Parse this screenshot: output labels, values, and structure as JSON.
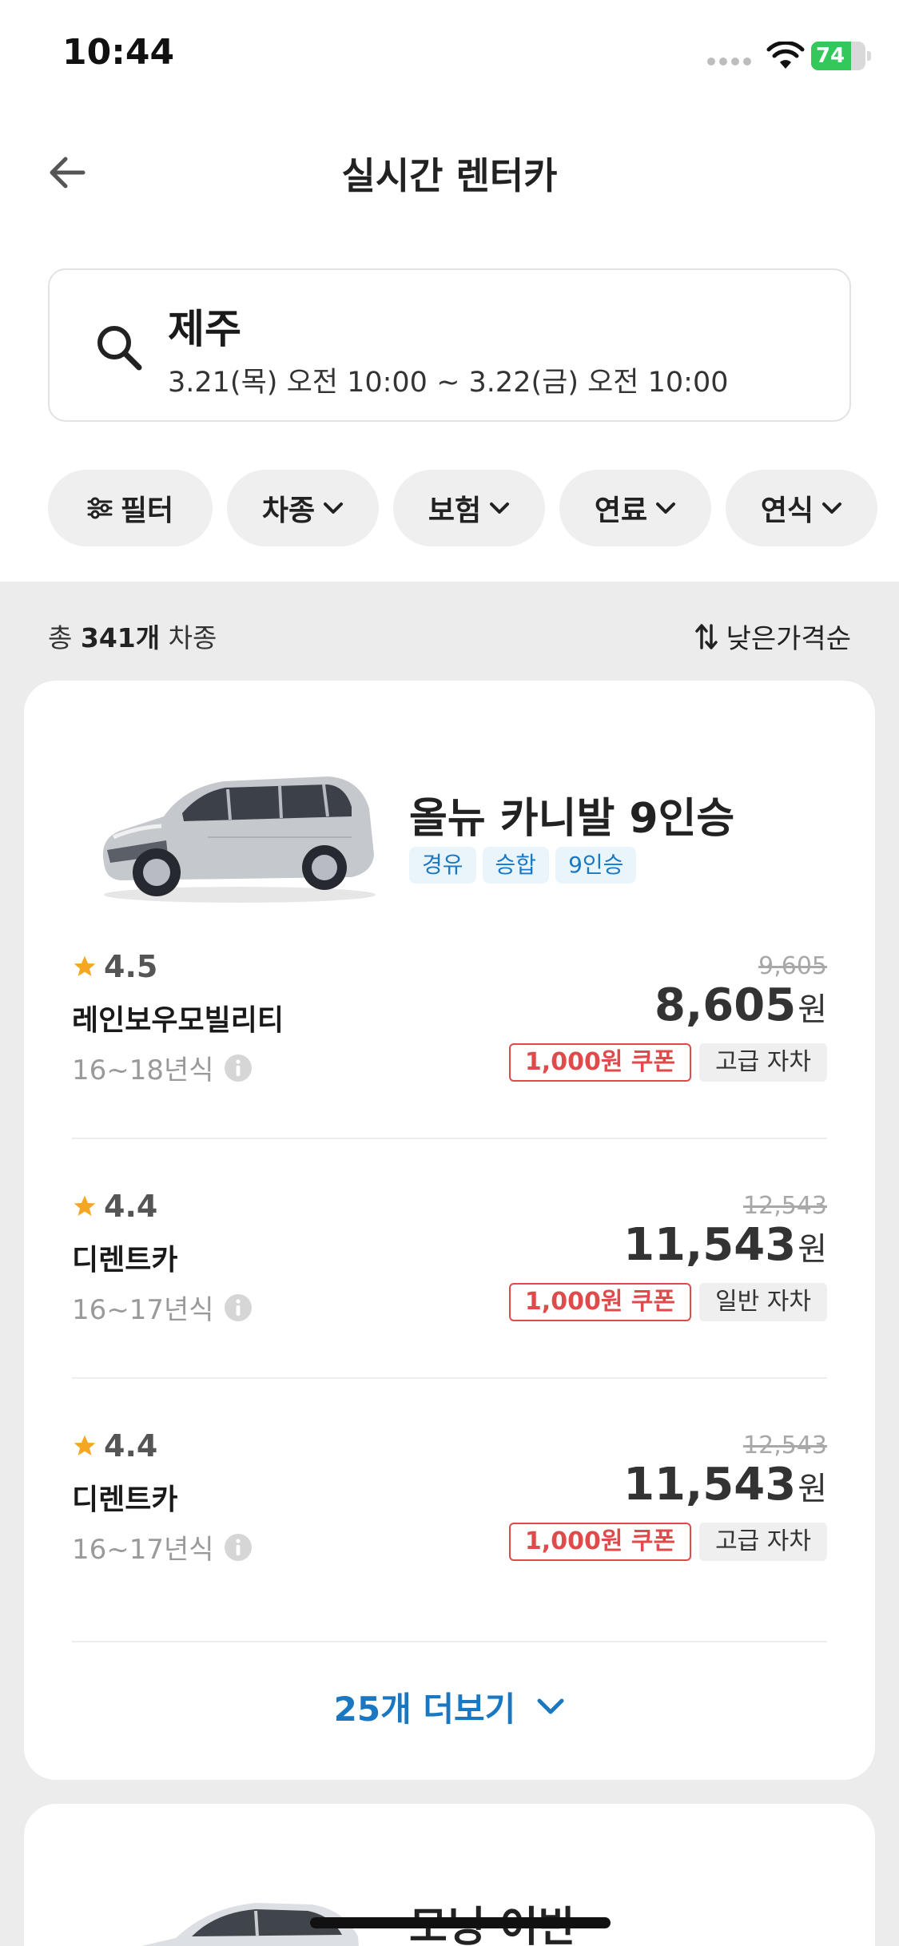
{
  "status_bar": {
    "time": "10:44",
    "battery": "74",
    "battery_level": 0.74
  },
  "header": {
    "title": "실시간 렌터카"
  },
  "search": {
    "location": "제주",
    "dates": "3.21(목) 오전 10:00 ~ 3.22(금) 오전 10:00"
  },
  "filters": [
    "필터",
    "차종",
    "보험",
    "연료",
    "연식"
  ],
  "list": {
    "total_prefix": "총 ",
    "total_count": "341개",
    "total_suffix": " 차종",
    "sort_label": "낮은가격순"
  },
  "car": {
    "name": "올뉴 카니발 9인승",
    "tags": [
      "경유",
      "승합",
      "9인승"
    ],
    "offers": [
      {
        "rating": "4.5",
        "company": "레인보우모빌리티",
        "year": "16~18년식",
        "original_price": "9,605",
        "price": "8,605",
        "unit": "원",
        "coupon": "1,000원 쿠폰",
        "grade": "고급 자차"
      },
      {
        "rating": "4.4",
        "company": "디렌트카",
        "year": "16~17년식",
        "original_price": "12,543",
        "price": "11,543",
        "unit": "원",
        "coupon": "1,000원 쿠폰",
        "grade": "일반 자차"
      },
      {
        "rating": "4.4",
        "company": "디렌트카",
        "year": "16~17년식",
        "original_price": "12,543",
        "price": "11,543",
        "unit": "원",
        "coupon": "1,000원 쿠폰",
        "grade": "고급 자차"
      }
    ],
    "more_label": "25개 더보기"
  },
  "next_car": {
    "name": "모닝 어반"
  },
  "colors": {
    "accent": "#1a78c2",
    "coupon": "#e04a4a",
    "star": "#f5a623",
    "battery": "#34c759"
  }
}
